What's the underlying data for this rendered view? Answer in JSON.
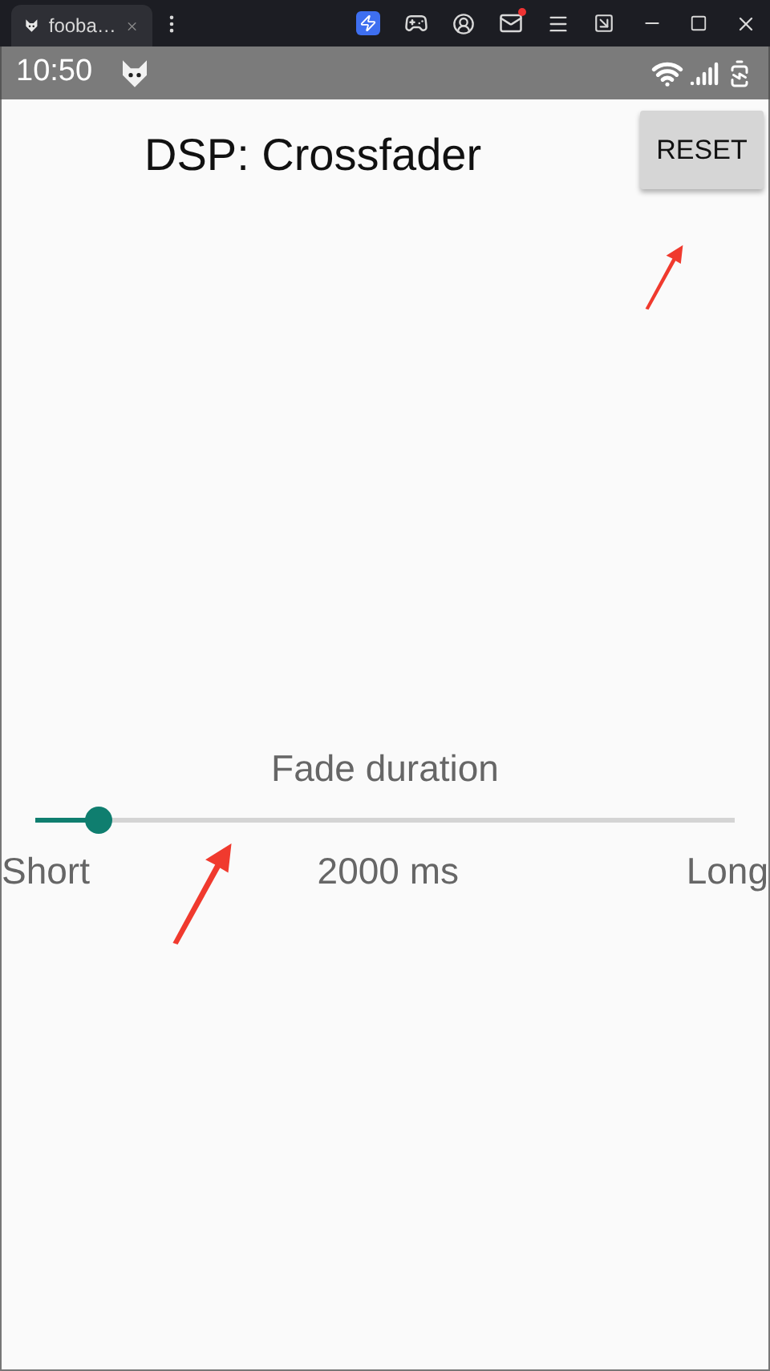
{
  "browser_tab": {
    "title": "fooba…",
    "selected": true
  },
  "status_bar": {
    "time": "10:50"
  },
  "title": "DSP: Crossfader",
  "reset_button": "RESET",
  "slider": {
    "label": "Fade duration",
    "level": 0.09,
    "min_label": "Short",
    "value": "2000 ms",
    "max_label": "Long"
  }
}
